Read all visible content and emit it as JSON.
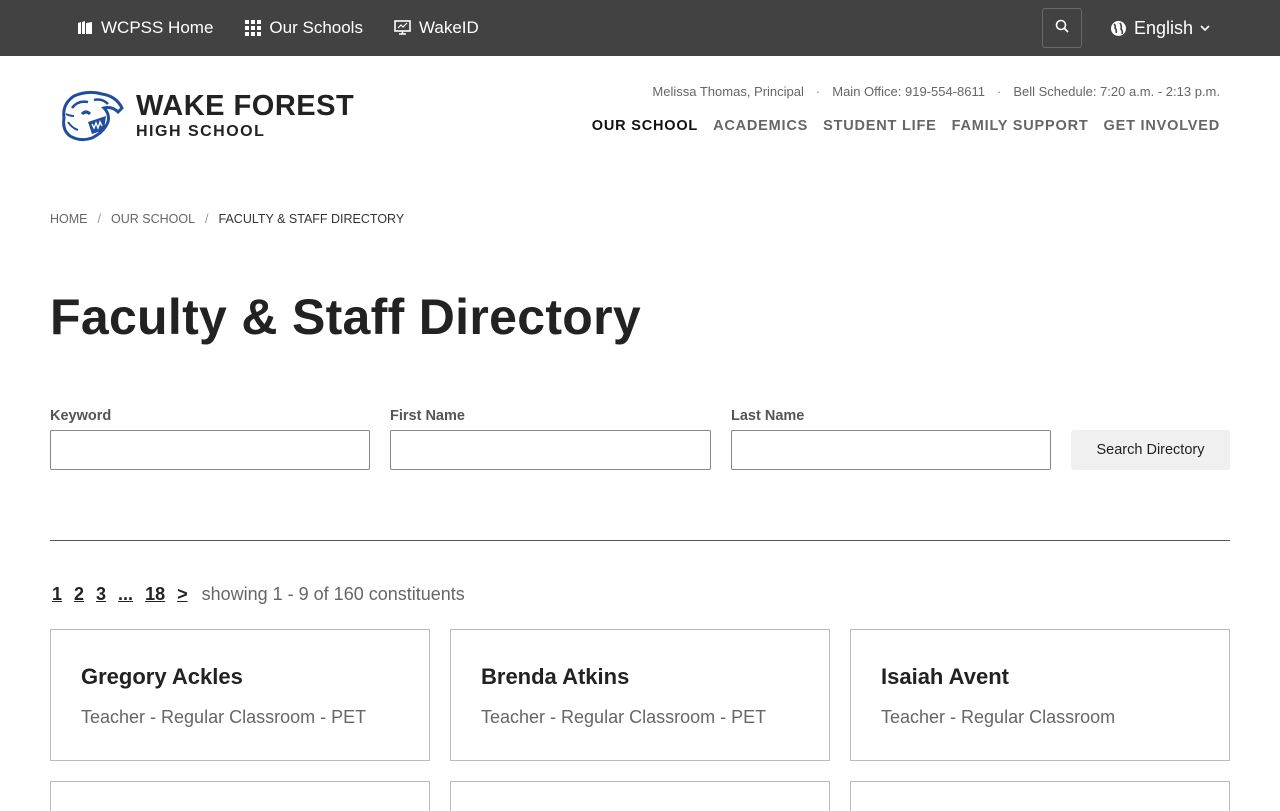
{
  "topbar": {
    "links": [
      {
        "label": "WCPSS Home"
      },
      {
        "label": "Our Schools"
      },
      {
        "label": "WakeID"
      }
    ],
    "language": "English"
  },
  "header": {
    "school_name_line1": "WAKE FOREST",
    "school_name_line2": "HIGH SCHOOL",
    "info": {
      "principal": "Melissa Thomas, Principal",
      "office": "Main Office: 919-554-8611",
      "bell": "Bell Schedule: 7:20 a.m. - 2:13 p.m."
    },
    "nav": [
      "OUR SCHOOL",
      "ACADEMICS",
      "STUDENT LIFE",
      "FAMILY SUPPORT",
      "GET INVOLVED"
    ]
  },
  "breadcrumb": [
    "HOME",
    "OUR SCHOOL",
    "FACULTY & STAFF DIRECTORY"
  ],
  "page_title": "Faculty & Staff Directory",
  "form": {
    "keyword_label": "Keyword",
    "keyword_value": "",
    "first_name_label": "First Name",
    "first_name_value": "",
    "last_name_label": "Last Name",
    "last_name_value": "",
    "submit_label": "Search Directory"
  },
  "pagination": {
    "pages": [
      "1",
      "2",
      "3",
      "...",
      "18",
      ">"
    ],
    "showing": "showing 1 - 9 of 160 constituents"
  },
  "staff": [
    {
      "name": "Gregory Ackles",
      "role": "Teacher - Regular Classroom - PET"
    },
    {
      "name": "Brenda Atkins",
      "role": "Teacher - Regular Classroom - PET"
    },
    {
      "name": "Isaiah Avent",
      "role": "Teacher - Regular Classroom"
    }
  ],
  "colors": {
    "topbar_bg": "#424242",
    "logo_blue": "#1f4e9c"
  }
}
